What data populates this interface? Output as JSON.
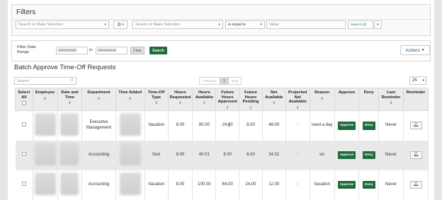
{
  "filters": {
    "title": "Filters",
    "field_placeholder_1": "Search or Make Selection",
    "field_placeholder_2": "Search or Make Selection",
    "operator": "is equal to",
    "value_placeholder": "Value",
    "search_label": "Search (0)"
  },
  "date_filter": {
    "label_line1": "Filter Date",
    "label_line2": "Range",
    "from": "00/00/0000",
    "to_label": "to",
    "to": "00/00/0000",
    "clear_label": "Clear",
    "search_label": "Search",
    "actions_label": "Actions"
  },
  "section_title": "Batch Approve Time-Off Requests",
  "table_controls": {
    "search_placeholder": "Search",
    "prev_label": "Previous",
    "page": "1",
    "next_label": "Next",
    "page_size": "25"
  },
  "columns": {
    "select_all": "Select All",
    "employee": "Employee",
    "date_time": "Date and Time",
    "department": "Department",
    "time_added": "Time Added",
    "type": "Time-Off Type",
    "hours_requested": "Hours Requested",
    "hours_available": "Hours Available",
    "future_approved": "Future Hours Approved",
    "future_pending": "Future Hours Pending",
    "net_available": "Net Available",
    "projected_net": "Projected Net Available",
    "reason": "Reason",
    "approve": "Approve",
    "deny": "Deny",
    "last_reminder": "Last Reminder",
    "reminder": "Reminder"
  },
  "rows": [
    {
      "department": "Executive Management",
      "type": "Vacation",
      "hours_requested": "8.00",
      "hours_available": "80.00",
      "future_approved": "24.00",
      "future_pending": "8.00",
      "net_available": "48.00",
      "reason": "need a day",
      "approve_label": "Approve",
      "deny_label": "Deny",
      "last_reminder": "Never"
    },
    {
      "department": "Accounting",
      "type": "Sick",
      "hours_requested": "8.00",
      "hours_available": "40.01",
      "future_approved": "8.00",
      "future_pending": "8.00",
      "net_available": "24.01",
      "reason": "sic",
      "approve_label": "Approve",
      "deny_label": "Deny",
      "last_reminder": "Never"
    },
    {
      "department": "Accounting",
      "type": "Vacation",
      "hours_requested": "8.00",
      "hours_available": "100.00",
      "future_approved": "64.00",
      "future_pending": "24.00",
      "net_available": "12.00",
      "reason": "Vacation",
      "approve_label": "Approve",
      "deny_label": "Deny",
      "last_reminder": "Never"
    }
  ],
  "colors": {
    "accent_green": "#1f6b3d",
    "link_blue": "#1f5a83"
  },
  "icons": [
    "gear-icon",
    "search-icon",
    "chevron-down-icon",
    "sort-icon",
    "spinner-icon",
    "bell-icon"
  ]
}
